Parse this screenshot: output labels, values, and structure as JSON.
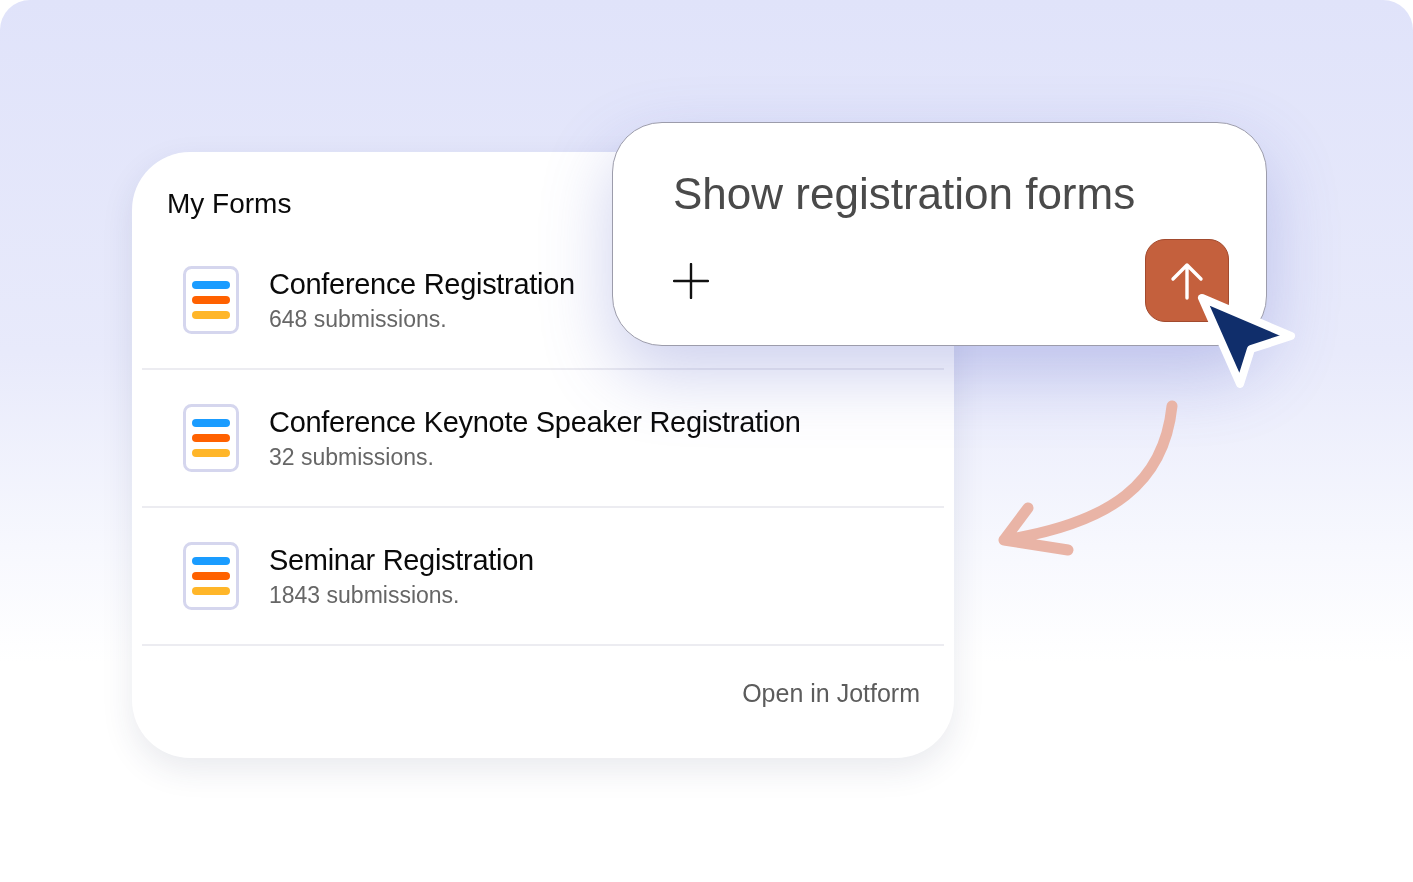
{
  "forms_panel": {
    "title": "My Forms",
    "forms": [
      {
        "name": "Conference Registration",
        "submissions": "648 submissions."
      },
      {
        "name": "Conference Keynote Speaker Registration",
        "submissions": "32 submissions."
      },
      {
        "name": "Seminar Registration",
        "submissions": "1843 submissions."
      }
    ],
    "footer_link": "Open in Jotform"
  },
  "prompt": {
    "value": "Show registration forms"
  }
}
